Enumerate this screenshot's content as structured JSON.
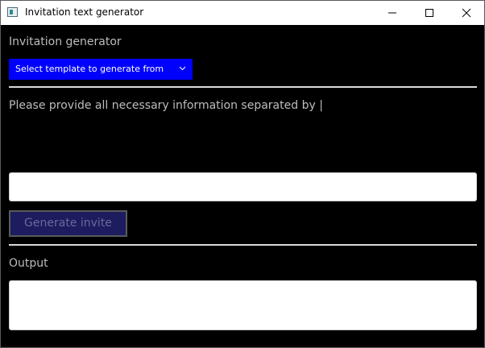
{
  "window": {
    "title": "Invitation text generator"
  },
  "main": {
    "heading": "Invitation generator",
    "template_select": {
      "selected": "Select template to generate from"
    },
    "prompt": "Please provide all necessary information separated by |",
    "info_input": {
      "value": "",
      "placeholder": ""
    },
    "generate_button": "Generate invite",
    "output_label": "Output",
    "output": {
      "value": ""
    }
  },
  "colors": {
    "background": "#000000",
    "select_background": "#0000ff",
    "button_background": "#1c1c5e",
    "label_text": "#bdbdbd"
  },
  "icons": [
    "app-icon",
    "minimize-icon",
    "maximize-icon",
    "close-icon",
    "chevron-down-icon"
  ]
}
